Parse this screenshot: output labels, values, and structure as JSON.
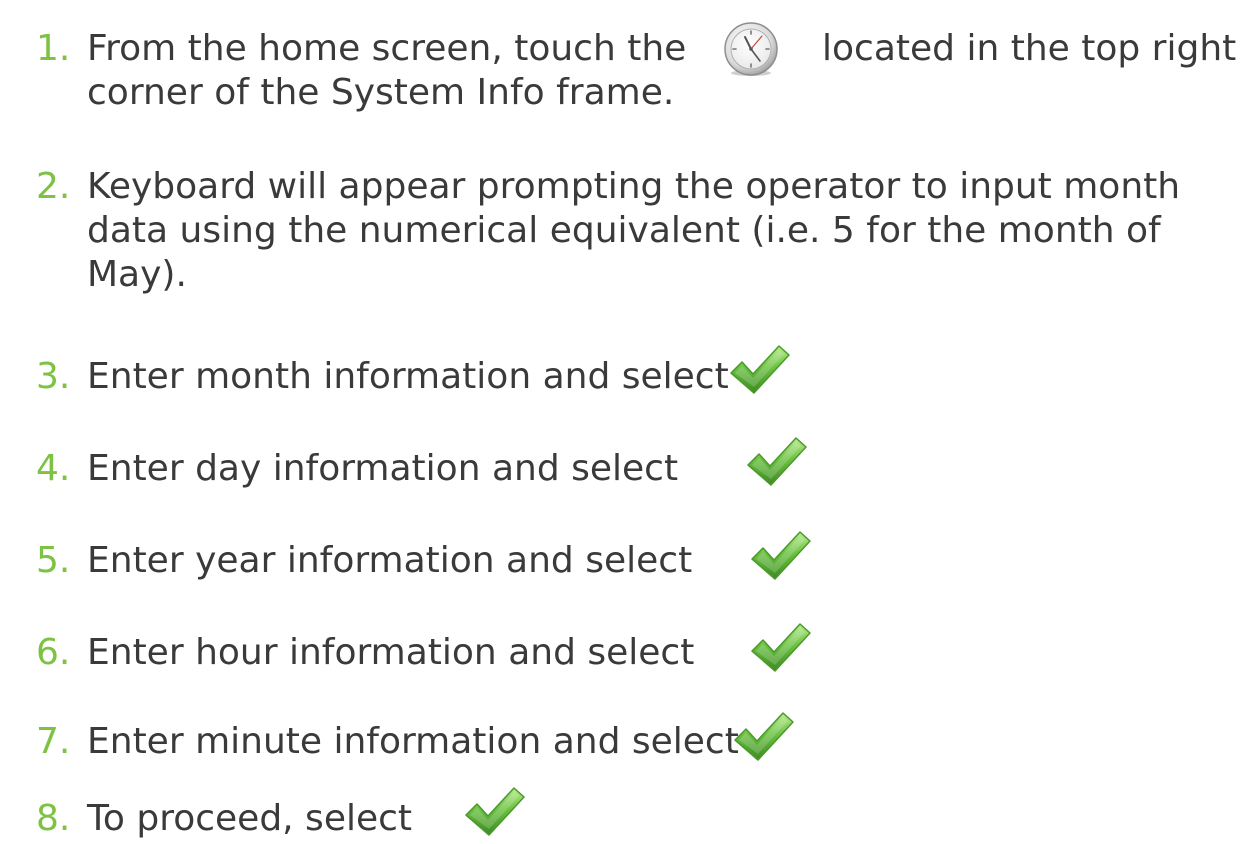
{
  "steps": [
    {
      "num": "1.",
      "lines": [
        "From the home screen, touch the",
        "corner of the System Info frame."
      ],
      "after_icon": "located in the top right",
      "icon": "clock-icon"
    },
    {
      "num": "2.",
      "lines": [
        "Keyboard will appear prompting the operator to input month",
        "data using the numerical equivalent (i.e. 5 for the month of",
        "May)."
      ]
    },
    {
      "num": "3.",
      "lines": [
        "Enter month information and select"
      ],
      "icon": "check-icon"
    },
    {
      "num": "4.",
      "lines": [
        "Enter day information and select"
      ],
      "icon": "check-icon"
    },
    {
      "num": "5.",
      "lines": [
        "Enter year information and select"
      ],
      "icon": "check-icon"
    },
    {
      "num": "6.",
      "lines": [
        "Enter hour information and select"
      ],
      "icon": "check-icon"
    },
    {
      "num": "7.",
      "lines": [
        "Enter minute information and select"
      ],
      "icon": "check-icon"
    },
    {
      "num": "8.",
      "lines": [
        "To proceed, select"
      ],
      "icon": "check-icon"
    }
  ],
  "colors": {
    "number": "#7dc242",
    "text": "#3a3a3a",
    "check_green": "#5fb53a",
    "check_dark": "#3d8a22"
  }
}
